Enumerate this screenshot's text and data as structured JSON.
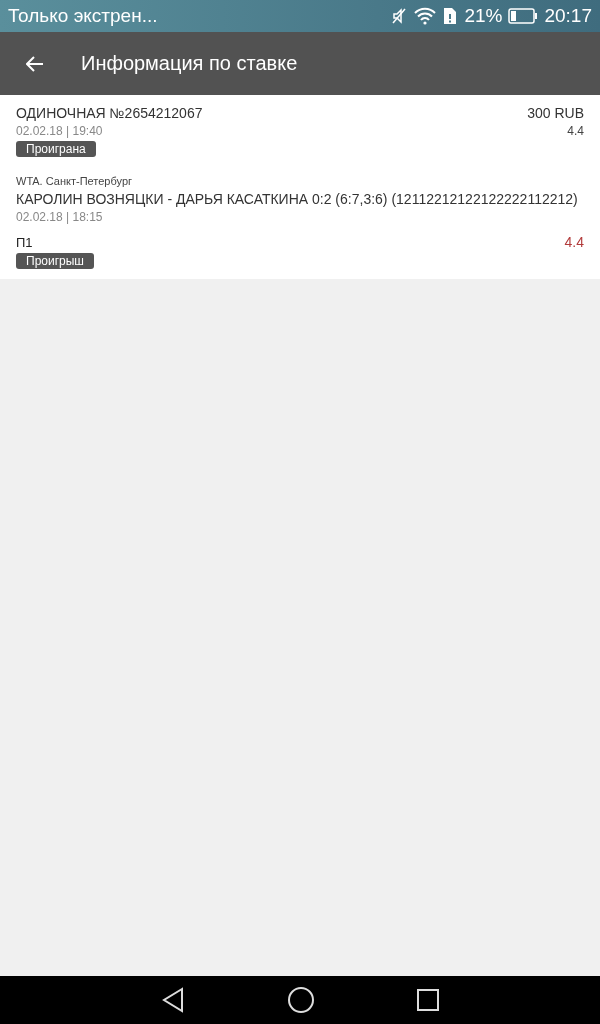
{
  "status_bar": {
    "notification": "Только экстрен...",
    "battery": "21%",
    "time": "20:17"
  },
  "toolbar": {
    "title": "Информация по ставке"
  },
  "bet": {
    "title": "ОДИНОЧНАЯ №2654212067",
    "amount": "300 RUB",
    "datetime": "02.02.18 | 19:40",
    "odds": "4.4",
    "status": "Проиграна"
  },
  "events": [
    {
      "league": "WTA. Санкт-Петербург",
      "match": "КАРОЛИН ВОЗНЯЦКИ - ДАРЬЯ КАСАТКИНА 0:2 (6:7,3:6) (12112212122122222112212)",
      "datetime": "02.02.18 | 18:15",
      "pick": "П1",
      "odds": "4.4",
      "result": "Проигрыш"
    }
  ]
}
